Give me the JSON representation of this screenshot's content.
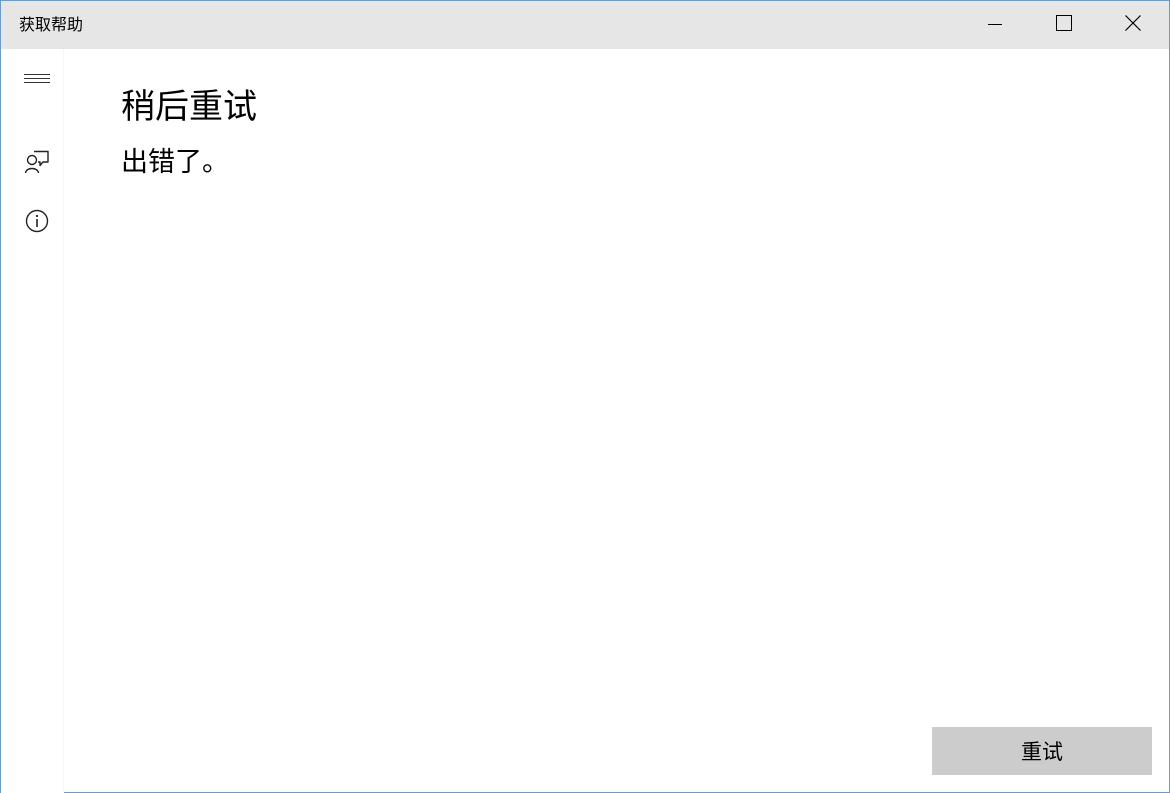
{
  "window": {
    "title": "获取帮助",
    "controls": {
      "minimize": "minimize-icon",
      "maximize": "maximize-icon",
      "close": "close-icon"
    }
  },
  "sidebar": {
    "items": [
      {
        "icon": "hamburger-menu-icon"
      },
      {
        "icon": "contact-support-icon"
      },
      {
        "icon": "info-icon"
      }
    ]
  },
  "main": {
    "heading": "稍后重试",
    "message": "出错了。"
  },
  "actions": {
    "retry_label": "重试"
  },
  "colors": {
    "titlebar_bg": "#e6e6e6",
    "button_bg": "#cccccc",
    "window_border": "#6b9bc7",
    "text": "#000000"
  }
}
